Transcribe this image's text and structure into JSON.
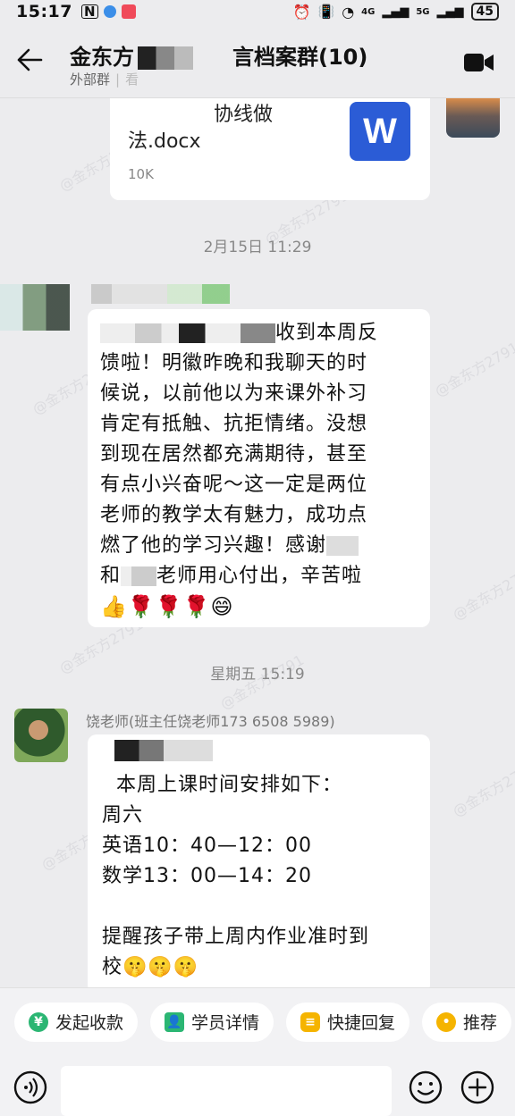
{
  "status": {
    "time": "15:17",
    "battery": "45",
    "signal1": "4G",
    "signal2": "5G"
  },
  "header": {
    "title_part1": "金东方",
    "title_part2": "言档案群(10)",
    "subtitle_label": "外部群",
    "subtitle_extra": "看"
  },
  "messages": {
    "file": {
      "name_line1": "协线做",
      "name_line2": "法.docx",
      "size": "10K",
      "icon_letter": "W"
    },
    "timestamp1": "2月15日  11:29",
    "msg1": {
      "line1_suffix": "收到本周反",
      "body": "馈啦！明徽昨晚和我聊天的时\n候说，以前他以为来课外补习\n肯定有抵触、抗拒情绪。没想\n到现在居然都充满期待，甚至\n有点小兴奋呢～这一定是两位\n老师的教学太有魅力，成功点\n燃了他的学习兴趣！感谢",
      "last_line_prefix": "和",
      "last_line_suffix": "老师用心付出，辛苦啦",
      "emojis": "👍🌹🌹🌹😄"
    },
    "timestamp2": "星期五  15:19",
    "msg2": {
      "sender": "饶老师(班主任饶老师173 6508 5989)",
      "body": "  本周上课时间安排如下：\n周六\n英语10：40—12：00\n数学13：00—14：20\n\n提醒孩子带上周内作业准时到\n校🤫🤫🤫"
    }
  },
  "watermark": "@金东方2791",
  "quick_actions": [
    {
      "label": "发起收款",
      "icon": "yen-icon",
      "color": "#2bb673"
    },
    {
      "label": "学员详情",
      "icon": "student-icon",
      "color": "#2bb673"
    },
    {
      "label": "快捷回复",
      "icon": "reply-icon",
      "color": "#f5b400"
    },
    {
      "label": "推荐",
      "icon": "recommend-icon",
      "color": "#f5b400"
    }
  ],
  "input": {
    "placeholder": ""
  }
}
